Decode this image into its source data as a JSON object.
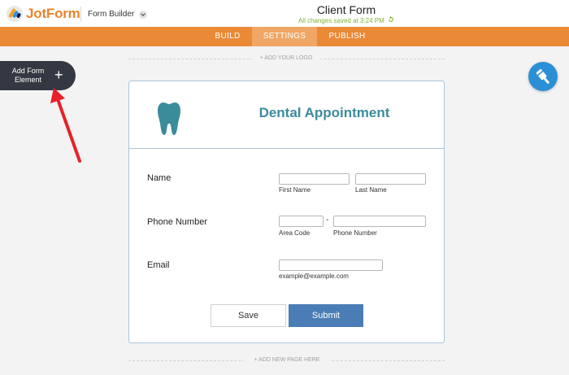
{
  "app": {
    "logo_text": "JotForm",
    "builder_label": "Form Builder",
    "form_title": "Client Form",
    "save_status": "All changes saved at 3:24 PM"
  },
  "nav": {
    "tabs": [
      {
        "label": "BUILD"
      },
      {
        "label": "SETTINGS",
        "active": true
      },
      {
        "label": "PUBLISH"
      }
    ]
  },
  "canvas": {
    "add_logo_label": "+ ADD YOUR LOGO",
    "add_page_label": "+ ADD NEW PAGE HERE"
  },
  "add_element": {
    "label": "Add Form Element",
    "icon": "plus-icon"
  },
  "form": {
    "heading": "Dental Appointment",
    "icon": "tooth-icon",
    "fields": {
      "name": {
        "label": "Name",
        "first_sublabel": "First Name",
        "last_sublabel": "Last Name",
        "first_value": "",
        "last_value": ""
      },
      "phone": {
        "label": "Phone Number",
        "separator": "-",
        "area_sublabel": "Area Code",
        "number_sublabel": "Phone Number",
        "area_value": "",
        "number_value": ""
      },
      "email": {
        "label": "Email",
        "sublabel": "example@example.com",
        "value": ""
      }
    },
    "buttons": {
      "save": "Save",
      "submit": "Submit"
    }
  },
  "colors": {
    "brand_orange": "#ea8a37",
    "active_tab": "#f0a765",
    "title_teal": "#3b8c9b",
    "submit_blue": "#4a7db5",
    "saved_green": "#7eb530",
    "designer_blue": "#2b8fd6",
    "annotation_arrow": "#e8202a"
  }
}
